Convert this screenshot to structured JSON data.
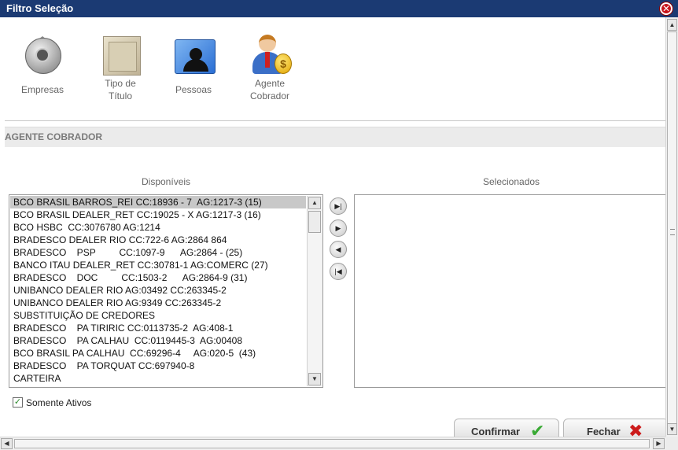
{
  "window": {
    "title": "Filtro Seleção",
    "close_glyph": "✕"
  },
  "toolbar": [
    {
      "label": "Empresas",
      "icon": "safe-icon"
    },
    {
      "label": "Tipo de\nTítulo",
      "icon": "document-folder-icon"
    },
    {
      "label": "Pessoas",
      "icon": "people-folder-icon"
    },
    {
      "label": "Agente\nCobrador",
      "icon": "agent-money-icon"
    }
  ],
  "section": {
    "title": "AGENTE COBRADOR"
  },
  "available": {
    "caption": "Disponíveis",
    "items": [
      "BCO BRASIL BARROS_REI CC:18936 - 7  AG:1217-3 (15)",
      "BCO BRASIL DEALER_RET CC:19025 - X AG:1217-3 (16)",
      "BCO HSBC  CC:3076780 AG:1214",
      "BRADESCO DEALER RIO CC:722-6 AG:2864 864",
      "BRADESCO    PSP         CC:1097-9      AG:2864 - (25)",
      "BANCO ITAU DEALER_RET CC:30781-1 AG:COMERC (27)",
      "BRADESCO    DOC         CC:1503-2      AG:2864-9 (31)",
      "UNIBANCO DEALER RIO AG:03492 CC:263345-2",
      "UNIBANCO DEALER RIO AG:9349 CC:263345-2",
      "SUBSTITUIÇÃO DE CREDORES",
      "BRADESCO    PA TIRIRIC CC:0113735-2  AG:408-1",
      "BRADESCO    PA CALHAU  CC:0119445-3  AG:00408",
      "BCO BRASIL PA CALHAU  CC:69296-4     AG:020-5  (43)",
      "BRADESCO    PA TORQUAT CC:697940-8",
      "CARTEIRA"
    ],
    "selected_index": 0
  },
  "selected": {
    "caption": "Selecionados",
    "items": []
  },
  "move_buttons": [
    {
      "name": "move-all-right-button",
      "glyph": "▶|"
    },
    {
      "name": "move-right-button",
      "glyph": "▶"
    },
    {
      "name": "move-left-button",
      "glyph": "◀"
    },
    {
      "name": "move-all-left-button",
      "glyph": "|◀"
    }
  ],
  "only_active": {
    "label": "Somente Ativos",
    "checked": true
  },
  "actions": {
    "confirm_label": "Confirmar",
    "confirm_color": "#3aaa35",
    "close_label": "Fechar",
    "close_color": "#cc1b1b"
  },
  "colors": {
    "titlebar": "#1b3a73",
    "selection": "#c8c8c8"
  }
}
